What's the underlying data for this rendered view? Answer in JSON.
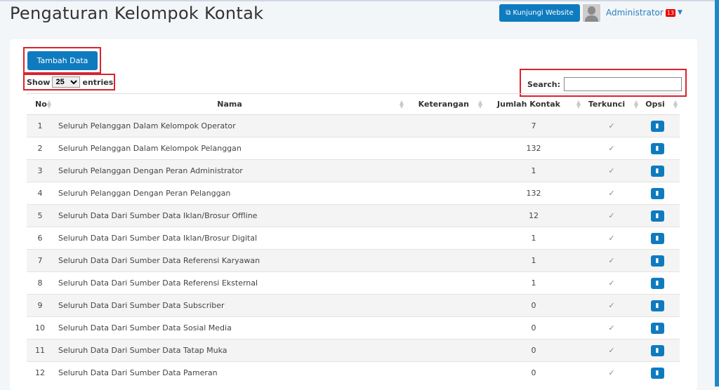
{
  "header": {
    "title": "Pengaturan Kelompok Kontak",
    "visit_label": "Kunjungi Website",
    "user": "Administrator",
    "notif_count": "13"
  },
  "toolbar": {
    "add_label": "Tambah Data",
    "show_label": "Show",
    "entries_value": "25",
    "entries_label": "entries",
    "search_label": "Search:",
    "search_value": ""
  },
  "table": {
    "columns": [
      "No",
      "Nama",
      "Keterangan",
      "Jumlah Kontak",
      "Terkunci",
      "Opsi"
    ],
    "rows": [
      {
        "no": "1",
        "nama": "Seluruh Pelanggan Dalam Kelompok Operator",
        "ket": "",
        "jumlah": "7",
        "lock": "✓"
      },
      {
        "no": "2",
        "nama": "Seluruh Pelanggan Dalam Kelompok Pelanggan",
        "ket": "",
        "jumlah": "132",
        "lock": "✓"
      },
      {
        "no": "3",
        "nama": "Seluruh Pelanggan Dengan Peran Administrator",
        "ket": "",
        "jumlah": "1",
        "lock": "✓"
      },
      {
        "no": "4",
        "nama": "Seluruh Pelanggan Dengan Peran Pelanggan",
        "ket": "",
        "jumlah": "132",
        "lock": "✓"
      },
      {
        "no": "5",
        "nama": "Seluruh Data Dari Sumber Data Iklan/Brosur Offline",
        "ket": "",
        "jumlah": "12",
        "lock": "✓"
      },
      {
        "no": "6",
        "nama": "Seluruh Data Dari Sumber Data Iklan/Brosur Digital",
        "ket": "",
        "jumlah": "1",
        "lock": "✓"
      },
      {
        "no": "7",
        "nama": "Seluruh Data Dari Sumber Data Referensi Karyawan",
        "ket": "",
        "jumlah": "1",
        "lock": "✓"
      },
      {
        "no": "8",
        "nama": "Seluruh Data Dari Sumber Data Referensi Eksternal",
        "ket": "",
        "jumlah": "1",
        "lock": "✓"
      },
      {
        "no": "9",
        "nama": "Seluruh Data Dari Sumber Data Subscriber",
        "ket": "",
        "jumlah": "0",
        "lock": "✓"
      },
      {
        "no": "10",
        "nama": "Seluruh Data Dari Sumber Data Sosial Media",
        "ket": "",
        "jumlah": "0",
        "lock": "✓"
      },
      {
        "no": "11",
        "nama": "Seluruh Data Dari Sumber Data Tatap Muka",
        "ket": "",
        "jumlah": "0",
        "lock": "✓"
      },
      {
        "no": "12",
        "nama": "Seluruh Data Dari Sumber Data Pameran",
        "ket": "",
        "jumlah": "0",
        "lock": "✓"
      }
    ]
  }
}
